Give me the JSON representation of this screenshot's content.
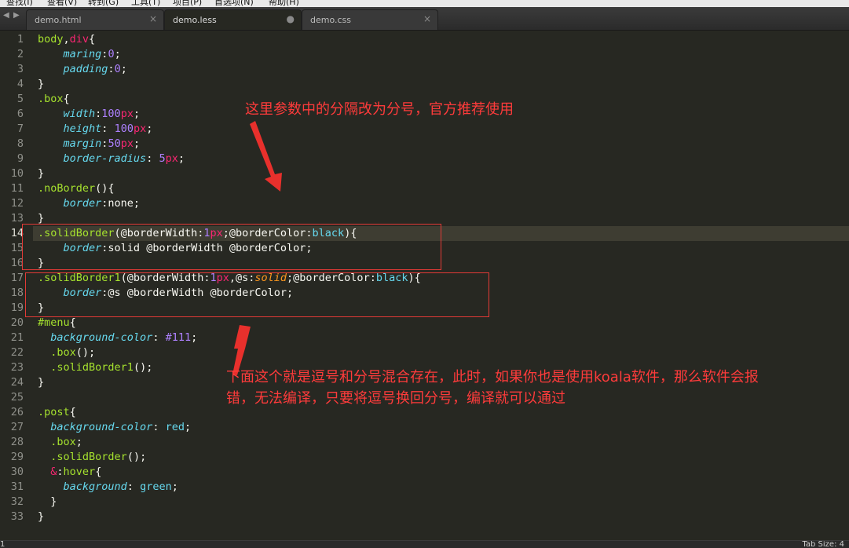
{
  "menu": [
    "查找(I)",
    "查看(V)",
    "转到(G)",
    "工具(T)",
    "项目(P)",
    "首选项(N)",
    "帮助(H)"
  ],
  "tabs": [
    {
      "label": "demo.html",
      "marker": "×"
    },
    {
      "label": "demo.less",
      "marker": "●"
    },
    {
      "label": "demo.css",
      "marker": "×"
    }
  ],
  "tab_nav": {
    "prev": "◀",
    "next": "▶"
  },
  "active_tab": "demo.less",
  "current_line": 14,
  "annotations": {
    "top": "这里参数中的分隔改为分号，官方推荐使用",
    "bottom_line1": "下面这个就是逗号和分号混合存在，此时，如果你也是使用koala软件，那么软件会报",
    "bottom_line2": "错，无法编译，只要将逗号换回分号，编译就可以通过"
  },
  "status": {
    "left": "1",
    "right": "Tab Size: 4"
  },
  "code": [
    [
      {
        "t": "body",
        "c": "sel"
      },
      {
        "t": ",",
        "c": ""
      },
      {
        "t": "div",
        "c": "tag"
      },
      {
        "t": "{",
        "c": ""
      }
    ],
    [
      {
        "t": "    ",
        "c": ""
      },
      {
        "t": "maring",
        "c": "prop"
      },
      {
        "t": ":",
        "c": ""
      },
      {
        "t": "0",
        "c": "num"
      },
      {
        "t": ";",
        "c": ""
      }
    ],
    [
      {
        "t": "    ",
        "c": ""
      },
      {
        "t": "padding",
        "c": "prop"
      },
      {
        "t": ":",
        "c": ""
      },
      {
        "t": "0",
        "c": "num"
      },
      {
        "t": ";",
        "c": ""
      }
    ],
    [
      {
        "t": "}",
        "c": ""
      }
    ],
    [
      {
        "t": ".box",
        "c": "sel"
      },
      {
        "t": "{",
        "c": ""
      }
    ],
    [
      {
        "t": "    ",
        "c": ""
      },
      {
        "t": "width",
        "c": "prop"
      },
      {
        "t": ":",
        "c": ""
      },
      {
        "t": "100",
        "c": "num"
      },
      {
        "t": "px",
        "c": "unit"
      },
      {
        "t": ";",
        "c": ""
      }
    ],
    [
      {
        "t": "    ",
        "c": ""
      },
      {
        "t": "height",
        "c": "prop"
      },
      {
        "t": ": ",
        "c": ""
      },
      {
        "t": "100",
        "c": "num"
      },
      {
        "t": "px",
        "c": "unit"
      },
      {
        "t": ";",
        "c": ""
      }
    ],
    [
      {
        "t": "    ",
        "c": ""
      },
      {
        "t": "margin",
        "c": "prop"
      },
      {
        "t": ":",
        "c": ""
      },
      {
        "t": "50",
        "c": "num"
      },
      {
        "t": "px",
        "c": "unit"
      },
      {
        "t": ";",
        "c": ""
      }
    ],
    [
      {
        "t": "    ",
        "c": ""
      },
      {
        "t": "border-radius",
        "c": "prop"
      },
      {
        "t": ": ",
        "c": ""
      },
      {
        "t": "5",
        "c": "num"
      },
      {
        "t": "px",
        "c": "unit"
      },
      {
        "t": ";",
        "c": ""
      }
    ],
    [
      {
        "t": "}",
        "c": ""
      }
    ],
    [
      {
        "t": ".noBorder",
        "c": "sel"
      },
      {
        "t": "(){",
        "c": ""
      }
    ],
    [
      {
        "t": "    ",
        "c": ""
      },
      {
        "t": "border",
        "c": "prop"
      },
      {
        "t": ":none;",
        "c": ""
      }
    ],
    [
      {
        "t": "}",
        "c": ""
      }
    ],
    [
      {
        "t": ".solidBorder",
        "c": "sel"
      },
      {
        "t": "(@borderWidth:",
        "c": ""
      },
      {
        "t": "1",
        "c": "num"
      },
      {
        "t": "px",
        "c": "unit"
      },
      {
        "t": ";@borderColor:",
        "c": ""
      },
      {
        "t": "black",
        "c": "const"
      },
      {
        "t": "){",
        "c": ""
      }
    ],
    [
      {
        "t": "    ",
        "c": ""
      },
      {
        "t": "border",
        "c": "prop"
      },
      {
        "t": ":solid @borderWidth @borderColor;",
        "c": ""
      }
    ],
    [
      {
        "t": "}",
        "c": ""
      }
    ],
    [
      {
        "t": ".solidBorder1",
        "c": "sel"
      },
      {
        "t": "(@borderWidth:",
        "c": ""
      },
      {
        "t": "1",
        "c": "num"
      },
      {
        "t": "px",
        "c": "unit"
      },
      {
        "t": ",@s:",
        "c": ""
      },
      {
        "t": "solid",
        "c": "it"
      },
      {
        "t": ";@borderColor:",
        "c": ""
      },
      {
        "t": "black",
        "c": "const"
      },
      {
        "t": "){",
        "c": ""
      }
    ],
    [
      {
        "t": "    ",
        "c": ""
      },
      {
        "t": "border",
        "c": "prop"
      },
      {
        "t": ":@s @borderWidth @borderColor;",
        "c": ""
      }
    ],
    [
      {
        "t": "}",
        "c": ""
      }
    ],
    [
      {
        "t": "#menu",
        "c": "sel"
      },
      {
        "t": "{",
        "c": ""
      }
    ],
    [
      {
        "t": "  ",
        "c": ""
      },
      {
        "t": "background-color",
        "c": "prop"
      },
      {
        "t": ": ",
        "c": ""
      },
      {
        "t": "#111",
        "c": "num"
      },
      {
        "t": ";",
        "c": ""
      }
    ],
    [
      {
        "t": "  ",
        "c": ""
      },
      {
        "t": ".box",
        "c": "sel"
      },
      {
        "t": "();",
        "c": ""
      }
    ],
    [
      {
        "t": "  ",
        "c": ""
      },
      {
        "t": ".solidBorder1",
        "c": "sel"
      },
      {
        "t": "();",
        "c": ""
      }
    ],
    [
      {
        "t": "}",
        "c": ""
      }
    ],
    [],
    [
      {
        "t": ".post",
        "c": "sel"
      },
      {
        "t": "{",
        "c": ""
      }
    ],
    [
      {
        "t": "  ",
        "c": ""
      },
      {
        "t": "background-color",
        "c": "prop"
      },
      {
        "t": ": ",
        "c": ""
      },
      {
        "t": "red",
        "c": "const"
      },
      {
        "t": ";",
        "c": ""
      }
    ],
    [
      {
        "t": "  ",
        "c": ""
      },
      {
        "t": ".box",
        "c": "sel"
      },
      {
        "t": ";",
        "c": ""
      }
    ],
    [
      {
        "t": "  ",
        "c": ""
      },
      {
        "t": ".solidBorder",
        "c": "sel"
      },
      {
        "t": "();",
        "c": ""
      }
    ],
    [
      {
        "t": "  ",
        "c": ""
      },
      {
        "t": "&",
        "c": "kw"
      },
      {
        "t": ":",
        "c": ""
      },
      {
        "t": "hover",
        "c": "sel"
      },
      {
        "t": "{",
        "c": ""
      }
    ],
    [
      {
        "t": "    ",
        "c": ""
      },
      {
        "t": "background",
        "c": "prop"
      },
      {
        "t": ": ",
        "c": ""
      },
      {
        "t": "green",
        "c": "const"
      },
      {
        "t": ";",
        "c": ""
      }
    ],
    [
      {
        "t": "  }",
        "c": ""
      }
    ],
    [
      {
        "t": "}",
        "c": ""
      }
    ]
  ]
}
